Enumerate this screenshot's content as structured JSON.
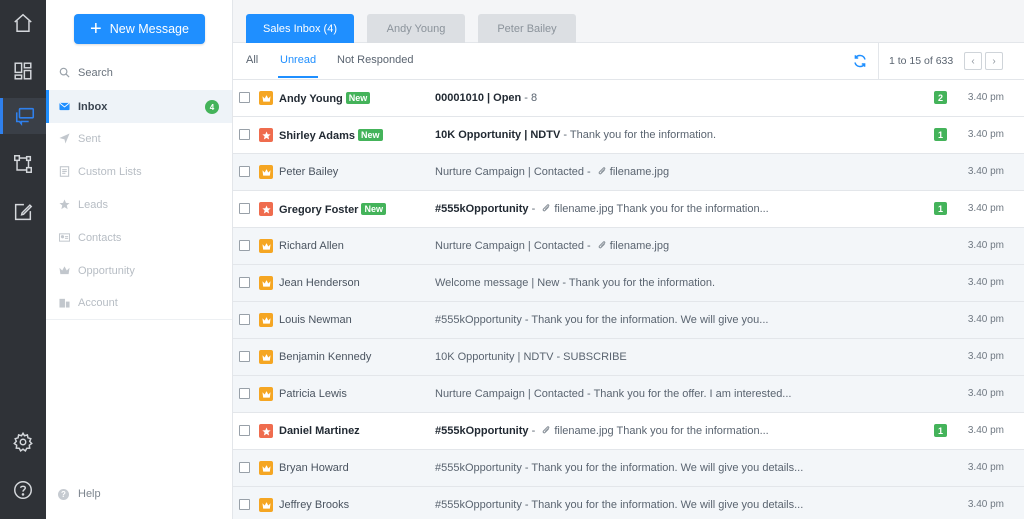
{
  "colors": {
    "accent": "#1f8fff",
    "rail": "#2f3237",
    "badge_green": "#44b35a",
    "avatar_orange": "#f5a623",
    "avatar_red": "#ef6c4e"
  },
  "rail": [
    {
      "icon": "home-icon"
    },
    {
      "icon": "dashboard-icon"
    },
    {
      "icon": "messages-icon",
      "active": true
    },
    {
      "icon": "workflow-icon"
    },
    {
      "icon": "compose-icon"
    },
    {
      "icon": "settings-icon"
    },
    {
      "icon": "help-circle-icon"
    }
  ],
  "folders": {
    "new_message": "New Message",
    "items": [
      {
        "label": "Search",
        "icon": "search-icon"
      },
      {
        "label": "Inbox",
        "icon": "inbox-icon",
        "count": "4"
      },
      {
        "label": "Sent",
        "icon": "send-icon"
      },
      {
        "label": "Custom Lists",
        "icon": "list-icon"
      },
      {
        "label": "Leads",
        "icon": "star-icon"
      },
      {
        "label": "Contacts",
        "icon": "contact-card-icon"
      },
      {
        "label": "Opportunity",
        "icon": "crown-icon"
      },
      {
        "label": "Account",
        "icon": "building-icon"
      }
    ],
    "help": "Help"
  },
  "tabs": [
    {
      "label": "Sales Inbox (4)",
      "active": true
    },
    {
      "label": "Andy Young"
    },
    {
      "label": "Peter Bailey"
    }
  ],
  "filters": [
    {
      "label": "All"
    },
    {
      "label": "Unread",
      "active": true
    },
    {
      "label": "Not Responded"
    }
  ],
  "pager": {
    "text": "1 to 15 of 633",
    "prev": "‹",
    "next": "›"
  },
  "messages": [
    {
      "name": "Andy Young",
      "is_new": true,
      "unread": true,
      "avatar": "orange",
      "subject": "00001010 | Open",
      "preview": " - 8",
      "attachment": "",
      "rest": "",
      "count": "2",
      "time": "3.40 pm"
    },
    {
      "name": "Shirley Adams",
      "is_new": true,
      "unread": true,
      "avatar": "red",
      "subject": "10K Opportunity | NDTV",
      "preview": " - Thank you for the information.",
      "attachment": "",
      "rest": "",
      "count": "1",
      "time": "3.40 pm"
    },
    {
      "name": "Peter Bailey",
      "is_new": false,
      "unread": false,
      "avatar": "orange",
      "subject": "Nurture Campaign | Contacted",
      "preview": " - ",
      "attachment": "filename.jpg",
      "rest": "",
      "count": "",
      "time": "3.40 pm"
    },
    {
      "name": "Gregory Foster",
      "is_new": true,
      "unread": true,
      "avatar": "red",
      "subject": "#555kOpportunity",
      "preview": " - ",
      "attachment": "filename.jpg",
      "rest": " Thank you for the information...",
      "count": "1",
      "time": "3.40 pm"
    },
    {
      "name": "Richard Allen",
      "is_new": false,
      "unread": false,
      "avatar": "orange",
      "subject": "Nurture Campaign | Contacted",
      "preview": " - ",
      "attachment": "filename.jpg",
      "rest": "",
      "count": "",
      "time": "3.40 pm"
    },
    {
      "name": "Jean Henderson",
      "is_new": false,
      "unread": false,
      "avatar": "orange",
      "subject": "Welcome message | New",
      "preview": " - Thank you for the information.",
      "attachment": "",
      "rest": "",
      "count": "",
      "time": "3.40 pm"
    },
    {
      "name": "Louis Newman",
      "is_new": false,
      "unread": false,
      "avatar": "orange",
      "subject": "#555kOpportunity",
      "preview": " -  Thank you for the information. We will give you...",
      "attachment": "",
      "rest": "",
      "count": "",
      "time": "3.40 pm"
    },
    {
      "name": "Benjamin Kennedy",
      "is_new": false,
      "unread": false,
      "avatar": "orange",
      "subject": "10K Opportunity | NDTV",
      "preview": " - SUBSCRIBE",
      "attachment": "",
      "rest": "",
      "count": "",
      "time": "3.40 pm"
    },
    {
      "name": "Patricia Lewis",
      "is_new": false,
      "unread": false,
      "avatar": "orange",
      "subject": "Nurture Campaign | Contacted",
      "preview": " - Thank you for the offer. I am interested...",
      "attachment": "",
      "rest": "",
      "count": "",
      "time": "3.40 pm"
    },
    {
      "name": "Daniel Martinez",
      "is_new": false,
      "unread": true,
      "avatar": "red",
      "subject": "#555kOpportunity",
      "preview": " - ",
      "attachment": "filename.jpg",
      "rest": " Thank you for the information...",
      "count": "1",
      "time": "3.40 pm"
    },
    {
      "name": "Bryan Howard",
      "is_new": false,
      "unread": false,
      "avatar": "orange",
      "subject": "#555kOpportunity",
      "preview": " -  Thank you for the information. We will give you details...",
      "attachment": "",
      "rest": "",
      "count": "",
      "time": "3.40 pm"
    },
    {
      "name": "Jeffrey Brooks",
      "is_new": false,
      "unread": false,
      "avatar": "orange",
      "subject": "#555kOpportunity",
      "preview": " -  Thank you for the information. We will give you details...",
      "attachment": "",
      "rest": "",
      "count": "",
      "time": "3.40 pm"
    }
  ],
  "new_badge_label": "New"
}
